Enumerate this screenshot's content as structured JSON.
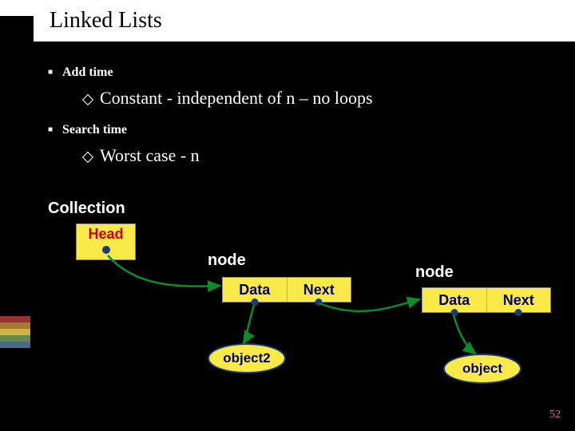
{
  "title": "Linked Lists",
  "bullets": {
    "add_time": "Add time",
    "add_time_detail": "Constant - independent of n – no loops",
    "search_time": "Search time",
    "search_time_detail": "Worst case - n"
  },
  "diagram": {
    "collection": "Collection",
    "head": "Head",
    "node1_label": "node",
    "node2_label": "node",
    "data": "Data",
    "next": "Next",
    "object2": "object2",
    "object": "object"
  },
  "page": "52"
}
